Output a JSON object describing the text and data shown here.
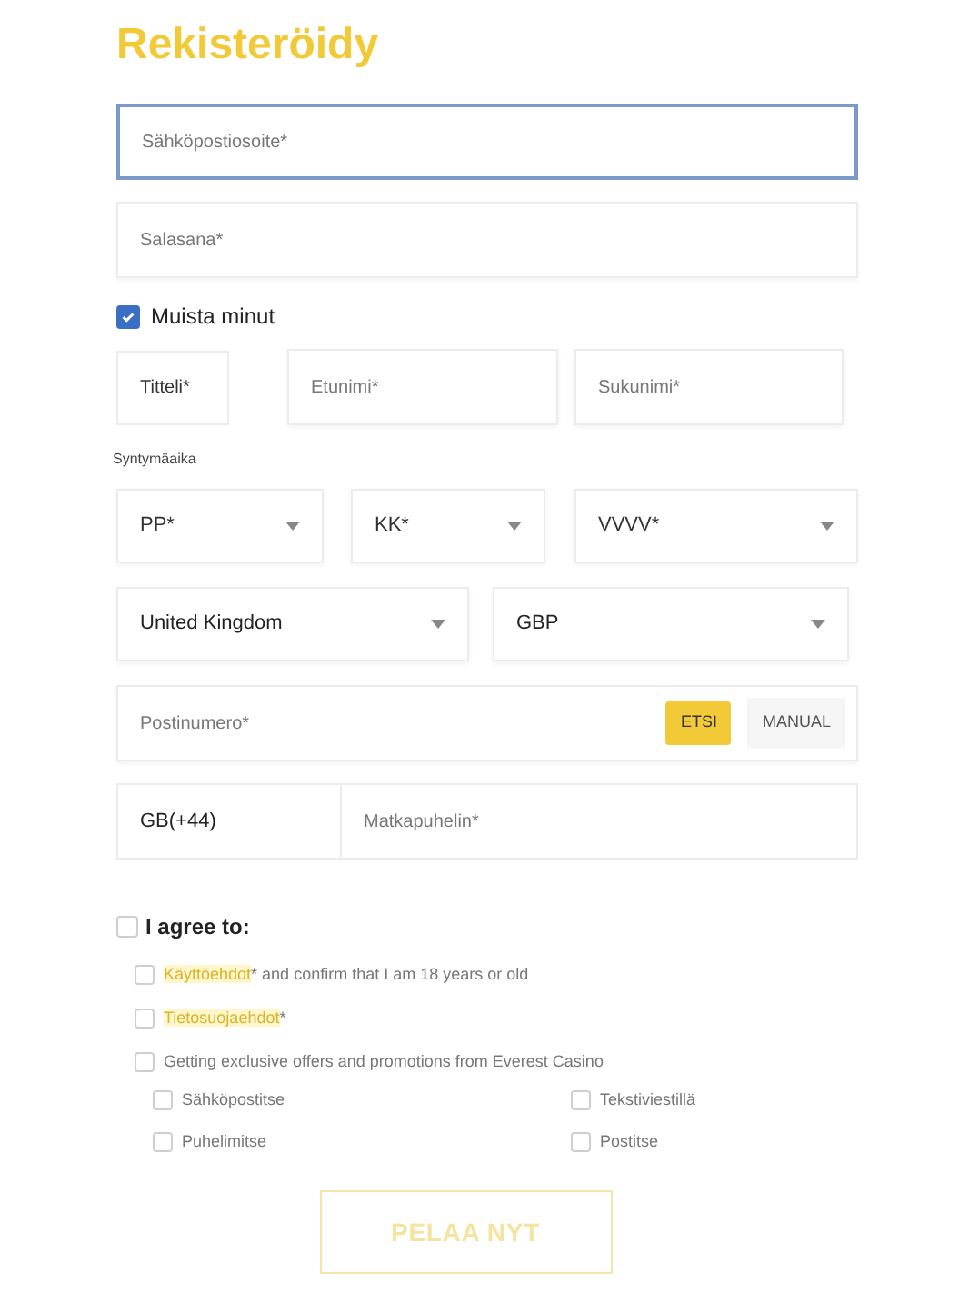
{
  "title": "Rekisteröidy",
  "email": {
    "placeholder": "Sähköpostiosoite*",
    "focused": true
  },
  "password": {
    "placeholder": "Salasana*"
  },
  "remember": {
    "label": "Muista minut",
    "checked": true
  },
  "name_row": {
    "title": {
      "placeholder": "Titteli*"
    },
    "first": {
      "placeholder": "Etunimi*"
    },
    "last": {
      "placeholder": "Sukunimi*"
    }
  },
  "birthdate": {
    "label": "Syntymäaika",
    "fields": [
      {
        "placeholder": "PP*"
      },
      {
        "placeholder": "KK*"
      },
      {
        "placeholder": "VVVV*"
      }
    ]
  },
  "country": {
    "value": "United Kingdom"
  },
  "currency": {
    "value": "GBP"
  },
  "postcode": {
    "placeholder": "Postinumero*",
    "search_button": "ETSI",
    "manual_button": "MANUAL"
  },
  "phone": {
    "prefix": "GB(+44)",
    "placeholder": "Matkapuhelin*"
  },
  "agree": {
    "label": "I agree to:",
    "checked": false,
    "items": [
      {
        "link": "Käyttöehdot",
        "text": "* and confirm that I am 18 years or old",
        "checked": false
      },
      {
        "link": "Tietosuojaehdot",
        "text": "*",
        "checked": false
      },
      {
        "text": "Getting exclusive offers and promotions from Everest Casino",
        "checked": false
      }
    ],
    "channels": [
      {
        "label": "Sähköpostitse",
        "checked": false
      },
      {
        "label": "Tekstiviestillä",
        "checked": false
      },
      {
        "label": "Puhelimitse",
        "checked": false
      },
      {
        "label": "Postitse",
        "checked": false
      }
    ]
  },
  "submit": {
    "label": "PELAA NYT",
    "disabled": true
  }
}
